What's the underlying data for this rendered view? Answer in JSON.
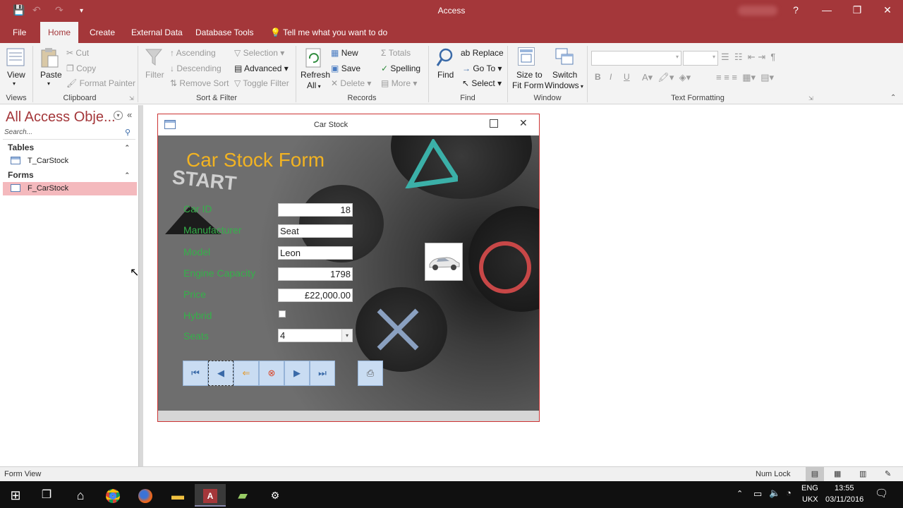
{
  "titlebar": {
    "title": "Access",
    "help": "?",
    "minimize": "—",
    "restore": "❐",
    "close": "✕"
  },
  "tabs": [
    "File",
    "Home",
    "Create",
    "External Data",
    "Database Tools"
  ],
  "tell_me": "Tell me what you want to do",
  "ribbon": {
    "views": {
      "view": "View",
      "group": "Views"
    },
    "clipboard": {
      "paste": "Paste",
      "cut": "Cut",
      "copy": "Copy",
      "format_painter": "Format Painter",
      "group": "Clipboard"
    },
    "sort_filter": {
      "filter": "Filter",
      "ascending": "Ascending",
      "descending": "Descending",
      "remove_sort": "Remove Sort",
      "selection": "Selection",
      "advanced": "Advanced",
      "toggle_filter": "Toggle Filter",
      "group": "Sort & Filter"
    },
    "records": {
      "refresh": "Refresh",
      "refresh_all": "All",
      "new": "New",
      "save": "Save",
      "delete": "Delete",
      "totals": "Totals",
      "spelling": "Spelling",
      "more": "More",
      "group": "Records"
    },
    "find": {
      "find": "Find",
      "replace": "Replace",
      "goto": "Go To",
      "select": "Select",
      "group": "Find"
    },
    "window": {
      "size_to_fit": "Size to",
      "size_to_fit2": "Fit Form",
      "switch": "Switch",
      "switch2": "Windows",
      "group": "Window"
    },
    "text_formatting": {
      "bold": "B",
      "italic": "I",
      "underline": "U",
      "group": "Text Formatting"
    }
  },
  "navpane": {
    "title": "All Access Obje...",
    "search_placeholder": "Search...",
    "sections": [
      {
        "name": "Tables",
        "items": [
          "T_CarStock"
        ]
      },
      {
        "name": "Forms",
        "items": [
          "F_CarStock"
        ]
      }
    ]
  },
  "form_window": {
    "title": "Car Stock",
    "heading": "Car Stock Form",
    "bg_text": "START",
    "fields": [
      {
        "label": "Car ID",
        "value": "18"
      },
      {
        "label": "Manufacturer",
        "value": "Seat"
      },
      {
        "label": "Model",
        "value": "Leon"
      },
      {
        "label": "Engine Capacity",
        "value": "1798"
      },
      {
        "label": "Price",
        "value": "£22,000.00"
      },
      {
        "label": "Hybrid",
        "value": false
      },
      {
        "label": "Seats",
        "value": "4"
      }
    ]
  },
  "statusbar": {
    "left": "Form View",
    "numlock": "Num Lock"
  },
  "taskbar": {
    "lang": "ENG",
    "region": "UKX",
    "time": "13:55",
    "date": "03/11/2016"
  },
  "colors": {
    "accent": "#a4373a",
    "label_green": "#35b14a",
    "heading_orange": "#f2b322"
  }
}
